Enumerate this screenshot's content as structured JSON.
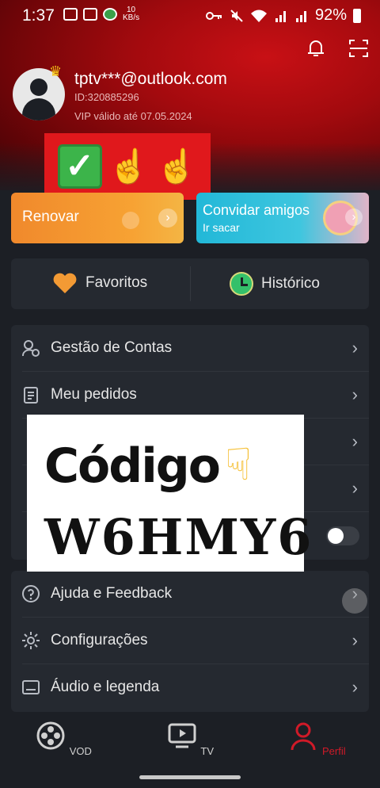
{
  "status_bar": {
    "time": "1:37",
    "speed_value": "10",
    "speed_unit": "KB/s",
    "battery": "92%"
  },
  "profile": {
    "email": "tptv***@outlook.com",
    "id_label": "ID:320885296",
    "vip_label": "VIP válido até 07.05.2024"
  },
  "cards": {
    "renovar_label": "Renovar",
    "convidar_label": "Convidar amigos",
    "convidar_sub": "Ir sacar"
  },
  "quick_actions": {
    "favoritos": "Favoritos",
    "historico": "Histórico"
  },
  "menu_group1": [
    {
      "label": "Gestão de Contas",
      "icon": "account-manage-icon"
    },
    {
      "label": "Meu pedidos",
      "icon": "orders-icon"
    }
  ],
  "menu_group2": [
    {
      "label": "Ajuda e Feedback",
      "icon": "help-icon"
    },
    {
      "label": "Configurações",
      "icon": "gear-icon"
    },
    {
      "label": "Áudio e legenda",
      "icon": "subtitles-icon"
    }
  ],
  "overlay": {
    "title": "Código",
    "code": "W6HMY6"
  },
  "tabs": {
    "vod": "VOD",
    "tv": "TV",
    "perfil": "Perfil"
  },
  "colors": {
    "accent_red": "#d01a28",
    "renovar_orange": "#f7a233",
    "convidar_blue": "#22b8d8",
    "background": "#1c1f25"
  }
}
